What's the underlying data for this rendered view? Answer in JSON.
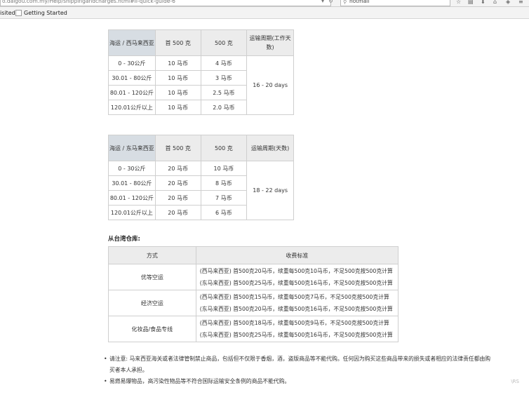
{
  "browser": {
    "url": "o.daigou.com.my/Help/shippingandcharges.html#II-quick-guide-6",
    "search_value": "hotmail",
    "bookmarks": {
      "visited": "isited",
      "getting_started": "Getting Started"
    }
  },
  "table1": {
    "headers": [
      "海运 / 西马来西亚",
      "首 500 克",
      "500 克",
      "运输周期(工作天数)"
    ],
    "rows": [
      [
        "0 - 30公斤",
        "10 马币",
        "4 马币"
      ],
      [
        "30.01 - 80公斤",
        "10 马币",
        "3 马币"
      ],
      [
        "80.01 - 120公斤",
        "10 马币",
        "2.5 马币"
      ],
      [
        "120.01公斤以上",
        "10 马币",
        "2.0 马币"
      ]
    ],
    "period": "16 - 20 days"
  },
  "table2": {
    "headers": [
      "海运 / 东马来西亚",
      "首 500 克",
      "500 克",
      "运输周期(天数)"
    ],
    "rows": [
      [
        "0 - 30公斤",
        "20 马币",
        "10 马币"
      ],
      [
        "30.01 - 80公斤",
        "20 马币",
        "8 马币"
      ],
      [
        "80.01 - 120公斤",
        "20 马币",
        "7 马币"
      ],
      [
        "120.01公斤以上",
        "20 马币",
        "6 马币"
      ]
    ],
    "period": "18 - 22 days"
  },
  "taiwan": {
    "title": "从台湾仓库:",
    "headers": [
      "方式",
      "收费标准"
    ],
    "rows": [
      {
        "method": "优等空运",
        "lines": [
          "(西马来西亚) 首500克20马币，续重每500克10马币，不足500克按500克计算",
          "(东马来西亚) 首500克25马币，续重每500克16马币，不足500克按500克计算"
        ]
      },
      {
        "method": "经济空运",
        "lines": [
          "(西马来西亚) 首500克15马币，续重每500克7马币，不足500克按500克计算",
          "(东马来西亚) 首500克20马币，续重每500克16马币，不足500克按500克计算"
        ]
      },
      {
        "method": "化妆品/食品专线",
        "lines": [
          "(西马来西亚) 首500克18马币，续重每500克9马币，不足500克按500克计算",
          "(东马来西亚) 首500克25马币，续重每500克16马币，不足500克按500克计算"
        ]
      }
    ]
  },
  "notes": [
    "请注意: 马来西亚海关或者法律管制禁止商品，包括但不仅限于香烟，酒，盗版商品等不能代购。任何因为购买这些商品带来的损失或者相应的法律责任都由购买者本人承担。",
    "易燃易爆物品，高污染性物品等不符合国际运输安全条例的商品不能代购。"
  ],
  "corner_text": "\\RS"
}
